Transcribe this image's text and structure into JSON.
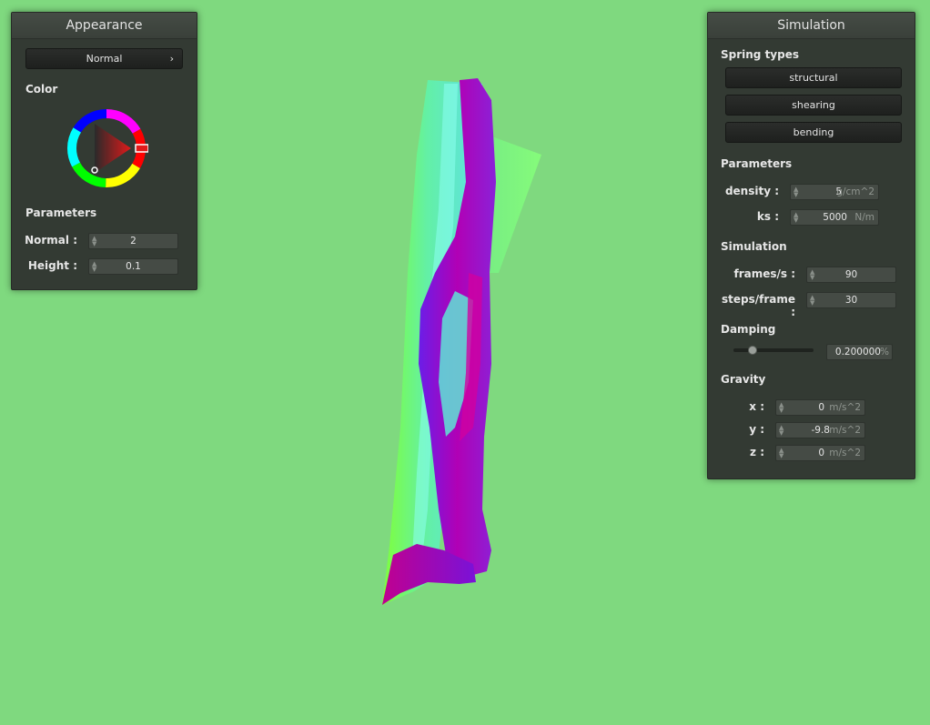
{
  "appearance": {
    "title": "Appearance",
    "mode_dropdown": {
      "value": "Normal",
      "chevron": "›"
    },
    "color_label": "Color",
    "parameters_label": "Parameters",
    "fields": [
      {
        "label": "Normal :",
        "value": "2"
      },
      {
        "label": "Height :",
        "value": "0.1"
      }
    ]
  },
  "simulation": {
    "title": "Simulation",
    "spring_types_label": "Spring types",
    "spring_buttons": [
      "structural",
      "shearing",
      "bending"
    ],
    "parameters_label": "Parameters",
    "parameters": [
      {
        "label": "density :",
        "value": "5",
        "unit": "g/cm^2"
      },
      {
        "label": "ks :",
        "value": "5000",
        "unit": "N/m"
      }
    ],
    "simulation_label": "Simulation",
    "simulation_fields": [
      {
        "label": "frames/s :",
        "value": "90"
      },
      {
        "label": "steps/frame :",
        "value": "30"
      }
    ],
    "damping_label": "Damping",
    "damping": {
      "value": "0.200000",
      "unit": "%",
      "slider_fraction": 0.2
    },
    "gravity_label": "Gravity",
    "gravity": [
      {
        "label": "x :",
        "value": "0",
        "unit": "m/s^2"
      },
      {
        "label": "y :",
        "value": "-9.8",
        "unit": "m/s^2"
      },
      {
        "label": "z :",
        "value": "0",
        "unit": "m/s^2"
      }
    ]
  },
  "colors": {
    "background": "#7fd97f",
    "panel": "#333a33",
    "cloth_green": "#7fff7f",
    "cloth_purple": "#8a00c8"
  },
  "icons": {
    "spinner": "spinner-arrows-icon",
    "color_wheel": "color-wheel-icon"
  }
}
